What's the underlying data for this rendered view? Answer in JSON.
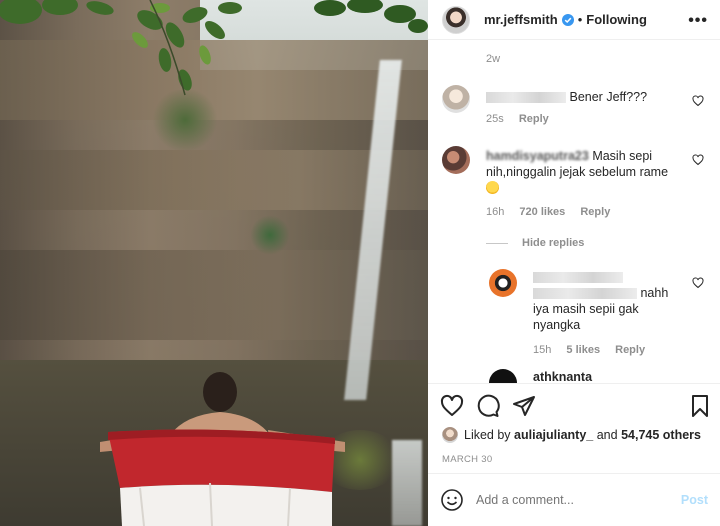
{
  "header": {
    "username": "mr.jeffsmith",
    "separator": "•",
    "follow_state": "Following",
    "more": "•••"
  },
  "post": {
    "timestamp_top": "2w",
    "liked_by_prefix": "Liked by",
    "liked_by_user": "auliajulianty_",
    "liked_by_and": "and",
    "likes_count": "54,745 others",
    "date": "MARCH 30"
  },
  "comments": [
    {
      "user": "",
      "text": "Bener Jeff???",
      "time": "25s",
      "likes": "",
      "reply": "Reply"
    },
    {
      "user": "hamdisyaputra23",
      "text_line1": "Masih sepi",
      "text_line2": "nih,ninggalin jejak sebelum rame",
      "time": "16h",
      "likes": "720 likes",
      "reply": "Reply"
    }
  ],
  "hide_replies": "Hide replies",
  "reply_comment": {
    "user": "",
    "text_line1": "nahh",
    "text_line2": "iya masih sepii gak",
    "text_line3": "nyangka",
    "time": "15h",
    "likes": "5 likes",
    "reply": "Reply"
  },
  "partial_comment": {
    "user": "athknanta"
  },
  "add_comment": {
    "placeholder": "Add a comment...",
    "post_label": "Post"
  },
  "colors": {
    "verified": "#3897f0",
    "post_disabled": "#b2dffc",
    "flag_red": "#c1272d"
  },
  "icons": {
    "like": "heart-icon",
    "comment": "comment-icon",
    "share": "paper-plane-icon",
    "save": "bookmark-icon",
    "emoji": "smiley-icon"
  }
}
